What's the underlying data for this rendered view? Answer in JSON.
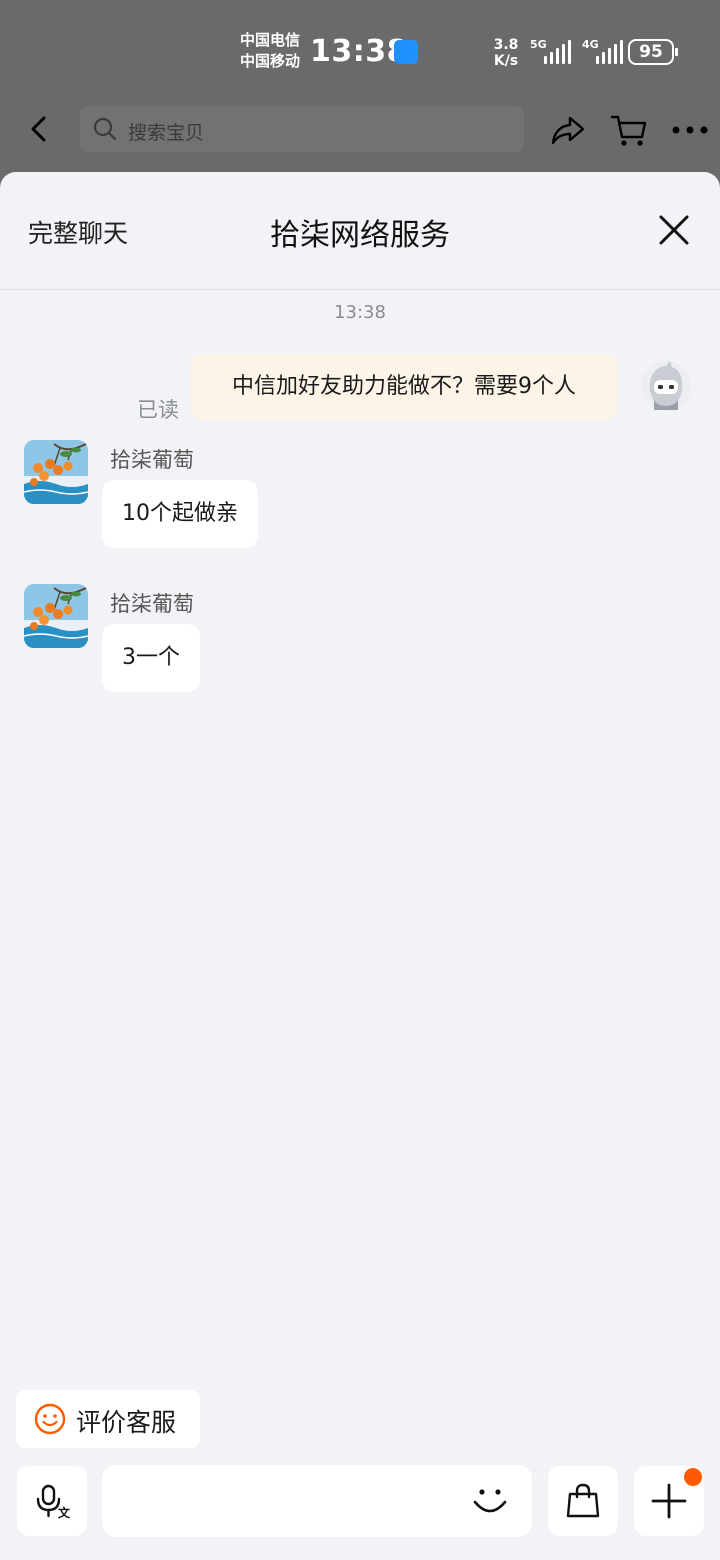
{
  "status_bar": {
    "carrier_1": "中国电信",
    "carrier_2": "中国移动",
    "time": "13:38",
    "net_speed_value": "3.8",
    "net_speed_unit": "K/s",
    "signal_1_label": "5G",
    "signal_2_label": "4G",
    "battery": "95"
  },
  "top_bar": {
    "search_placeholder": "搜索宝贝"
  },
  "chat_header": {
    "full_chat_label": "完整聊天",
    "title": "拾柒网络服务"
  },
  "messages": {
    "timestamp": "13:38",
    "outgoing": {
      "text": "中信加好友助力能做不？需要9个人",
      "read_status": "已读"
    },
    "incoming": [
      {
        "sender": "拾柒葡萄",
        "text": "10个起做亲"
      },
      {
        "sender": "拾柒葡萄",
        "text": "3一个"
      }
    ]
  },
  "footer": {
    "rate_label": "评价客服",
    "input_value": "",
    "voice_badge_char": "文"
  },
  "colors": {
    "accent_orange": "#ff5a00",
    "outgoing_bubble": "#fdf4e8",
    "sheet_background": "#f2f3f7"
  },
  "icons": {
    "back": "chevron-left-icon",
    "search": "search-icon",
    "share": "share-icon",
    "cart": "cart-icon",
    "more": "more-dots-icon",
    "close": "close-icon",
    "rate": "smile-icon",
    "voice": "microphone-icon",
    "emoji": "emoji-icon",
    "product": "shopping-bag-icon",
    "plus": "plus-icon"
  }
}
